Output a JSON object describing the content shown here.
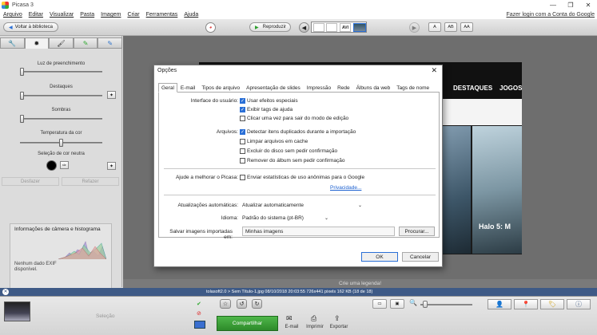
{
  "window": {
    "title": "Picasa 3",
    "controls": [
      "—",
      "❐",
      "✕"
    ]
  },
  "menu": {
    "items": [
      "Arquivo",
      "Editar",
      "Visualizar",
      "Pasta",
      "Imagem",
      "Criar",
      "Ferramentas",
      "Ajuda"
    ],
    "login_link": "Fazer login com a Conta do Google"
  },
  "toolbar": {
    "back_label": "Voltar à biblioteca",
    "play_label": "Reproduzir",
    "thumb_label": "AVI",
    "text_size_buttons": [
      "A",
      "AB",
      "AA"
    ]
  },
  "left_panel": {
    "tabs": [
      "wrench",
      "sun",
      "brush",
      "brush-color",
      "brush-blue"
    ],
    "fill_light_label": "Luz de preenchimento",
    "highlights_label": "Destaques",
    "shadows_label": "Sombras",
    "color_temp_label": "Temperatura da cor",
    "neutral_color_label": "Seleção de cor neutra",
    "undo_label": "Desfazer",
    "redo_label": "Refazer",
    "histogram_title": "Informações de câmera e histograma",
    "no_exif": "Nenhum dado EXIF disponível."
  },
  "photo": {
    "nav_items": [
      "DESTAQUES",
      "JOGOS"
    ],
    "overlay_text": "Halo 5: M"
  },
  "caption": {
    "placeholder": "Crie uma legenda!"
  },
  "status": {
    "text": "tolasoft2.0 > Sem Título-1.jpg    08/10/2018 20:03:55    726x441 pixels    162 KB    (18 de 18)"
  },
  "tray": {
    "selection_label": "Seleção",
    "share_label": "Compartilhar",
    "email_label": "E-mail",
    "print_label": "Imprimir",
    "export_label": "Exportar"
  },
  "dialog": {
    "title": "Opções",
    "close": "✕",
    "tabs": [
      "Geral",
      "E-mail",
      "Tipos de arquivo",
      "Apresentação de slides",
      "Impressão",
      "Rede",
      "Álbuns da web",
      "Tags de nome"
    ],
    "interface_label": "Interface do usuário:",
    "interface_options": [
      {
        "label": "Usar efeitos especiais",
        "checked": true
      },
      {
        "label": "Exibir tags de ajuda",
        "checked": true
      },
      {
        "label": "Clicar uma vez para sair do modo de edição",
        "checked": false
      }
    ],
    "files_label": "Arquivos:",
    "files_options": [
      {
        "label": "Detectar itens duplicados durante a importação",
        "checked": true
      },
      {
        "label": "Limpar arquivos em cache",
        "checked": false
      },
      {
        "label": "Excluir do disco sem pedir confirmação",
        "checked": false
      },
      {
        "label": "Remover do álbum sem pedir confirmação",
        "checked": false
      }
    ],
    "improve_label": "Ajude a melhorar o Picasa:",
    "improve_option": {
      "label": "Enviar estatísticas de uso anônimas para o Google",
      "checked": false
    },
    "privacy_link": "Privacidade...",
    "auto_update_label": "Atualizações automáticas:",
    "auto_update_value": "Atualizar automaticamente",
    "language_label": "Idioma:",
    "language_value": "Padrão do sistema (pt-BR)",
    "save_imported_label": "Salvar imagens importadas em:",
    "save_imported_value": "Minhas imagens",
    "browse_label": "Procurar...",
    "ok_label": "OK",
    "cancel_label": "Cancelar"
  },
  "colors": {
    "accent": "#2a6fd6",
    "status_bar": "#3e5a86",
    "share_green": "#3aa036"
  }
}
